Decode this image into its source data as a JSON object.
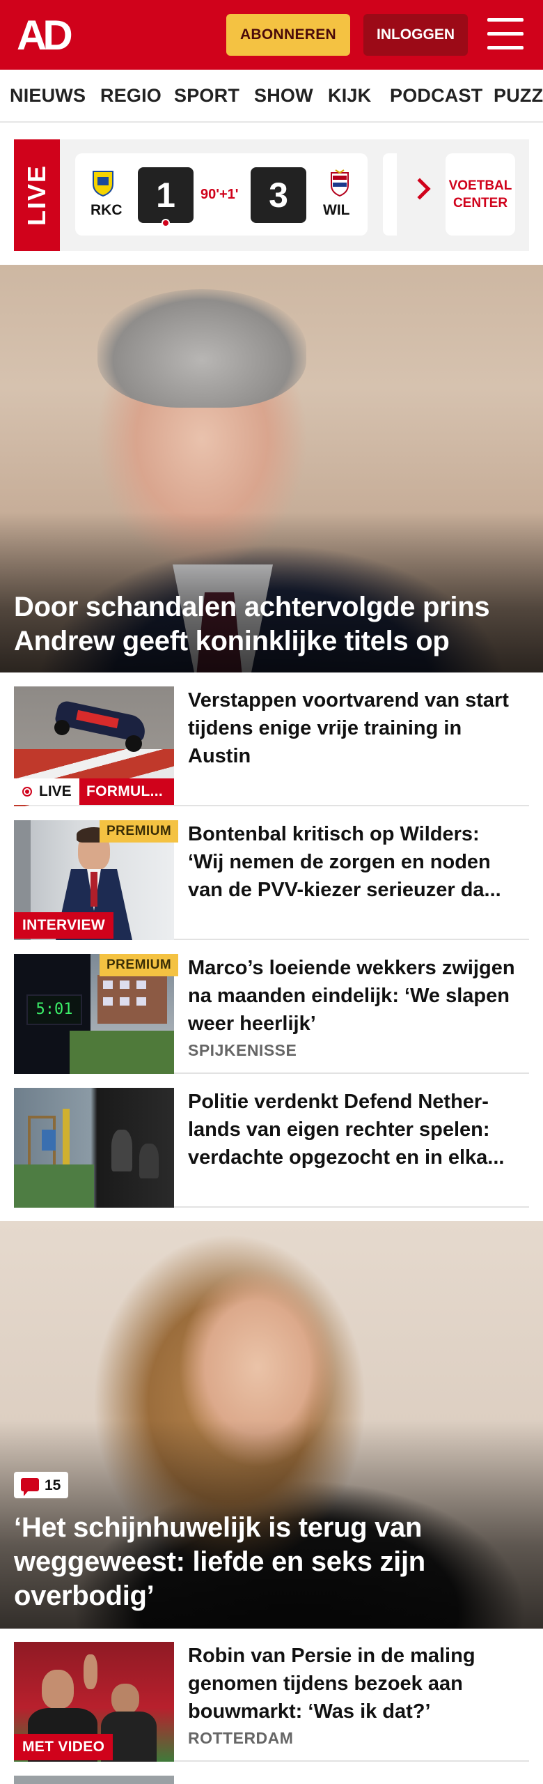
{
  "header": {
    "logo": "AD",
    "subscribe_label": "ABONNEREN",
    "login_label": "INLOGGEN",
    "brand_color": "#d0021b"
  },
  "nav": {
    "items": [
      "NIEUWS",
      "REGIO",
      "SPORT",
      "SHOW",
      "KIJK",
      "PODCAST",
      "PUZZ"
    ]
  },
  "live": {
    "tag": "LIVE",
    "match": {
      "home": "RKC",
      "away": "WIL",
      "home_score": "1",
      "away_score": "3",
      "minute": "90'+1'"
    },
    "voetbal_center": "VOETBAL CENTER"
  },
  "hero1": {
    "title": "Door schandalen achtervolgde prins Andrew geeft koninklijke titels op"
  },
  "articles": [
    {
      "title": "Verstappen voortvarend van start tijdens enige vrije training in Austin",
      "live_label": "LIVE",
      "label": "FORMUL..."
    },
    {
      "title": "Bontenbal kritisch op Wilders: ‘Wij nemen de zorgen en noden van de PVV-kiezer serieuzer da...",
      "premium": "PREMIUM",
      "label": "INTERVIEW"
    },
    {
      "title": "Marco’s loeiende wekkers zwijgen na maanden eindelijk: ‘We slapen weer heerlijk’",
      "premium": "PREMIUM",
      "place": "SPIJKENISSE",
      "clock": "5:01"
    },
    {
      "title": "Politie verdenkt Defend Nether­lands van eigen rechter spelen: verdachte opgezocht en in elka..."
    }
  ],
  "hero2": {
    "comments": "15",
    "title": "‘Het schijnhuwelijk is terug van weggeweest: liefde en seks zijn overbodig’"
  },
  "articles2": [
    {
      "title": "Robin van Persie in de maling genomen tijdens bezoek aan bouwmarkt: ‘Was ik dat?’",
      "place": "ROTTERDAM",
      "label": "MET VIDEO"
    }
  ]
}
